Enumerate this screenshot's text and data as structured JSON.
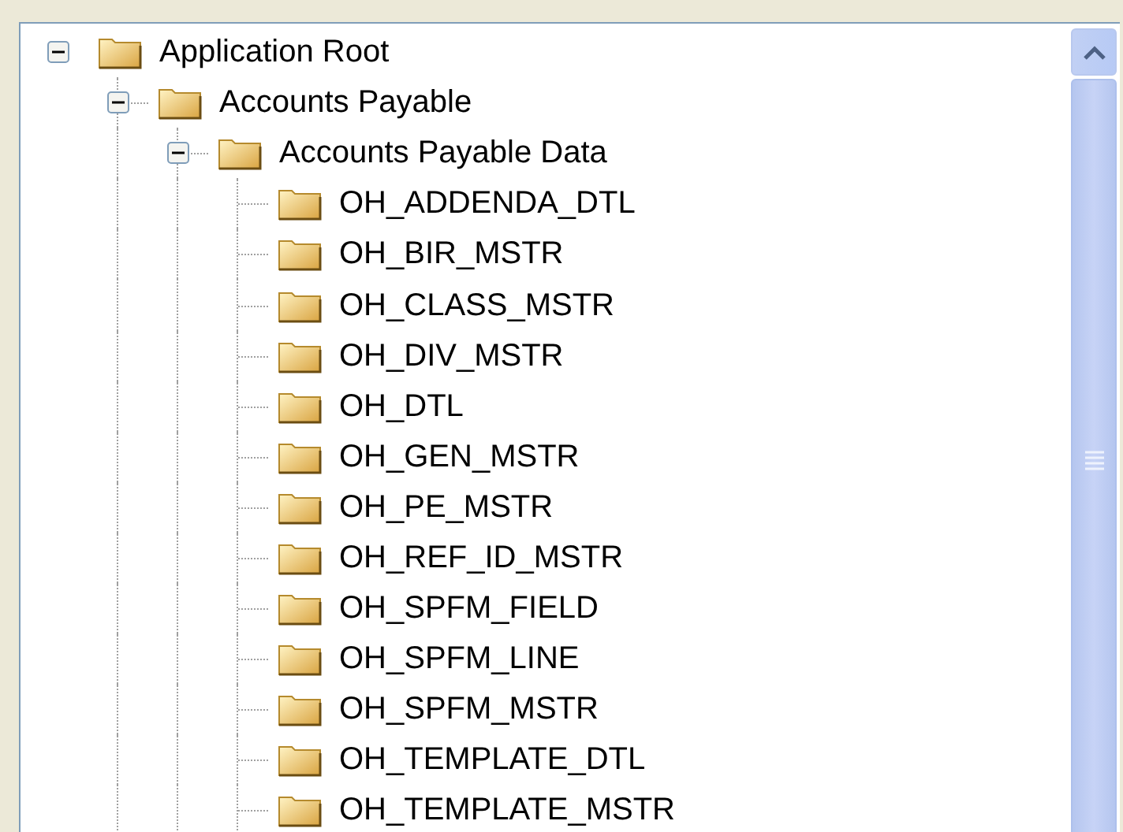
{
  "tree": [
    {
      "label": "Application Root",
      "expanded": true,
      "children": [
        {
          "label": "Accounts Payable",
          "expanded": true,
          "children": [
            {
              "label": "Accounts Payable Data",
              "expanded": true,
              "children": [
                {
                  "label": "OH_ADDENDA_DTL"
                },
                {
                  "label": "OH_BIR_MSTR"
                },
                {
                  "label": "OH_CLASS_MSTR"
                },
                {
                  "label": "OH_DIV_MSTR"
                },
                {
                  "label": "OH_DTL"
                },
                {
                  "label": "OH_GEN_MSTR"
                },
                {
                  "label": "OH_PE_MSTR"
                },
                {
                  "label": "OH_REF_ID_MSTR"
                },
                {
                  "label": "OH_SPFM_FIELD"
                },
                {
                  "label": "OH_SPFM_LINE"
                },
                {
                  "label": "OH_SPFM_MSTR"
                },
                {
                  "label": "OH_TEMPLATE_DTL"
                },
                {
                  "label": "OH_TEMPLATE_MSTR"
                }
              ]
            }
          ]
        }
      ]
    }
  ]
}
